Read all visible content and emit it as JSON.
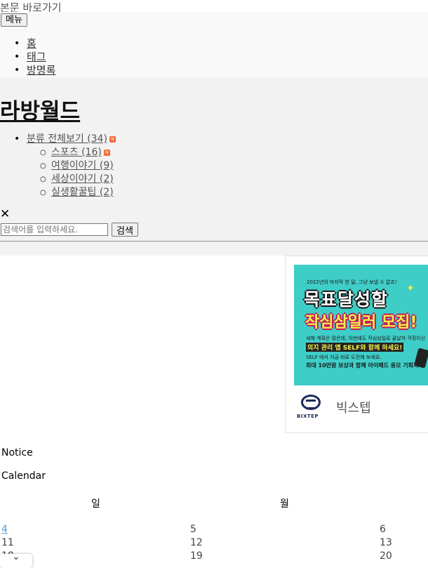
{
  "skip_link": "본문 바로가기",
  "menu_button": "메뉴",
  "nav": [
    "홈",
    "태그",
    "방명록"
  ],
  "site_title": "라방월드",
  "categories": {
    "all": "분류 전체보기",
    "all_count": "(34)",
    "children": [
      {
        "label": "스포츠",
        "count": "(16)",
        "new": true
      },
      {
        "label": "여행이야기",
        "count": "(9)",
        "new": false
      },
      {
        "label": "세상이야기",
        "count": "(2)",
        "new": false
      },
      {
        "label": "실생활꿀팁",
        "count": "(2)",
        "new": false
      }
    ],
    "new_badge": "N"
  },
  "search": {
    "placeholder": "검색어를 입력하세요.",
    "button": "검색"
  },
  "ad": {
    "banner_line1": "2022년의 마지막 한 달, 그냥 보낼 수 없죠!",
    "banner_title": "목표달성할",
    "banner_subtitle": "작심삼일러 모집!",
    "banner_line3": "새해 계획은 많은데, 이번에도 작심삼일로 끝날까 걱정이신가요?",
    "banner_line4": "의지 관리 앱 SELF와 함께 하세요!",
    "banner_line5": "SELF 에서 지금 바로 도전해 보세요.",
    "banner_line6": "최대 10만원 보상과 함께 아이패드 응모 기회까지!",
    "logo_text": "BIXTEP",
    "brand": "빅스텝"
  },
  "notice_label": "Notice",
  "calendar_label": "Calendar",
  "calendar": {
    "headers": [
      "일",
      "월"
    ],
    "rows": [
      [
        "4",
        "5",
        "6"
      ],
      [
        "11",
        "12",
        "13"
      ],
      [
        "18",
        "19",
        "20"
      ]
    ],
    "today": "4"
  }
}
